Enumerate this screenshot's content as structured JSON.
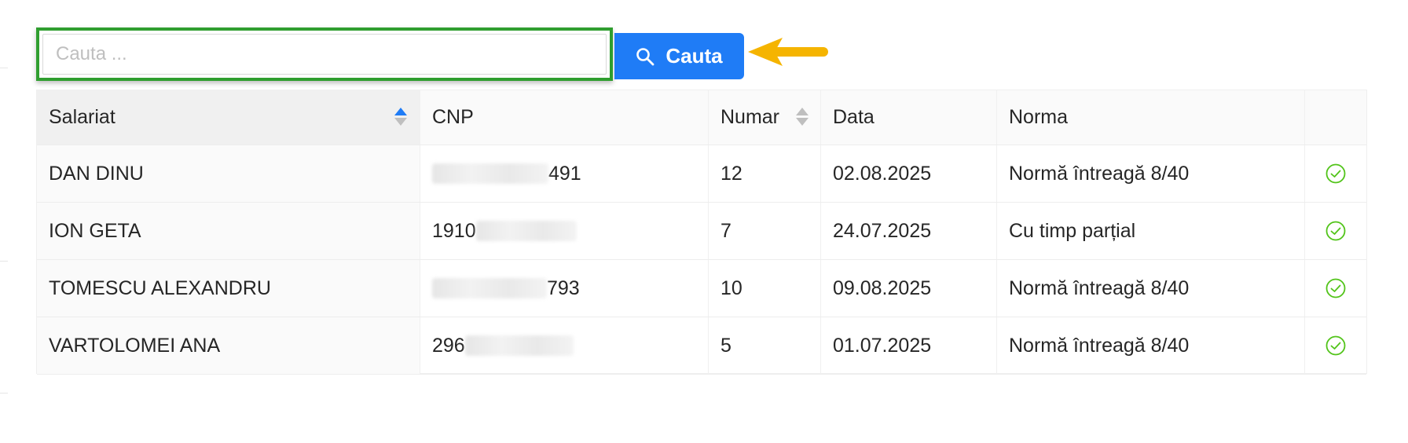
{
  "search": {
    "placeholder": "Cauta ...",
    "button_label": "Cauta",
    "button_icon": "search-icon"
  },
  "table": {
    "columns": [
      {
        "label": "Salariat",
        "sortable": true,
        "sort": "ascending"
      },
      {
        "label": "CNP",
        "sortable": false
      },
      {
        "label": "Numar",
        "sortable": true
      },
      {
        "label": "Data",
        "sortable": false
      },
      {
        "label": "Norma",
        "sortable": false
      },
      {
        "label": "",
        "sortable": false
      }
    ],
    "rows": [
      {
        "salariat": "DAN DINU",
        "cnp_visible": "491",
        "numar": "12",
        "data": "02.08.2025",
        "norma": "Normă întreagă 8/40",
        "status_icon": "check-circle-icon"
      },
      {
        "salariat": "ION GETA",
        "cnp_visible": "1910",
        "numar": "7",
        "data": "24.07.2025",
        "norma": "Cu timp parțial",
        "status_icon": "check-circle-icon"
      },
      {
        "salariat": "TOMESCU ALEXANDRU",
        "cnp_visible": "793",
        "numar": "10",
        "data": "09.08.2025",
        "norma": "Normă întreagă 8/40",
        "status_icon": "check-circle-icon"
      },
      {
        "salariat": "VARTOLOMEI ANA",
        "cnp_visible": "296",
        "numar": "5",
        "data": "01.07.2025",
        "norma": "Normă întreagă 8/40",
        "status_icon": "check-circle-icon"
      }
    ]
  },
  "colors": {
    "primary": "#1f7cf6",
    "highlight_border": "#2f9e2f",
    "annotation_arrow": "#f5b400",
    "status_ok": "#52c41a"
  }
}
